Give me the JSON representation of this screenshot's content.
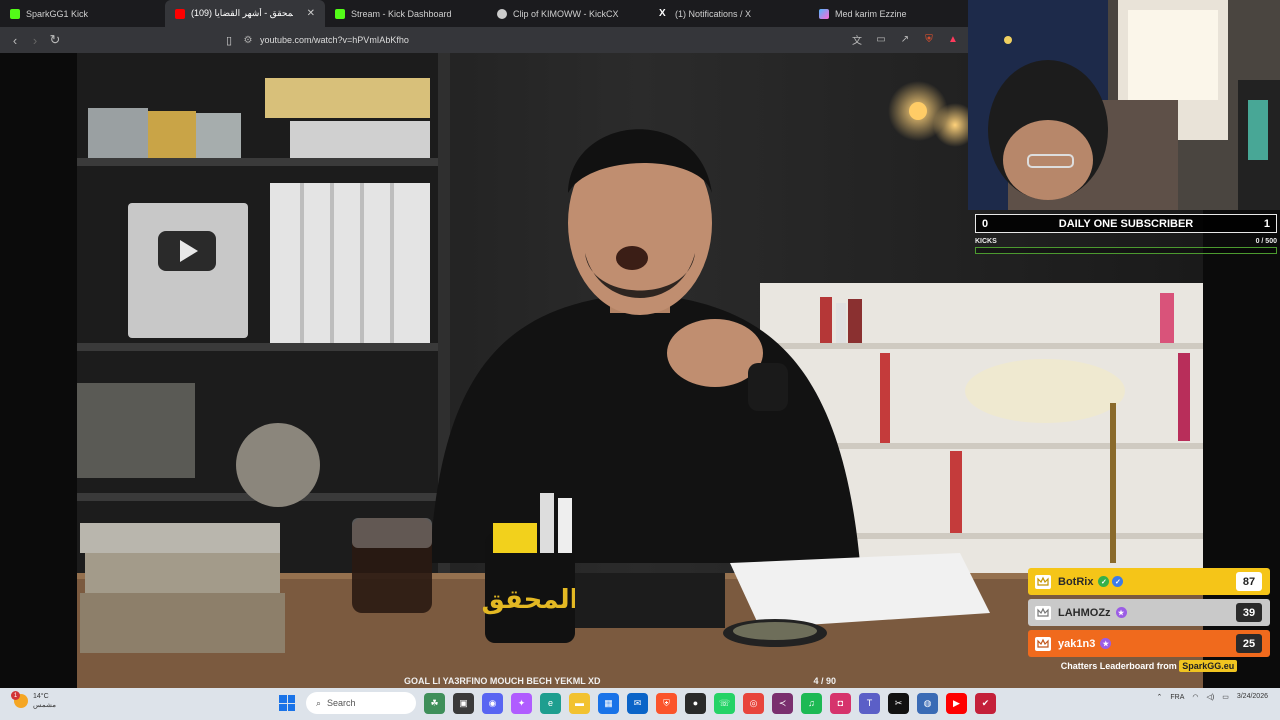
{
  "tabs": [
    {
      "label": "SparkGG1 Kick",
      "color": "#53fc18",
      "active": false
    },
    {
      "label": "(109) المحقق - أشهر القضايا !",
      "color": "#ff0000",
      "active": true
    },
    {
      "label": "Stream - Kick Dashboard",
      "color": "#53fc18",
      "active": false
    },
    {
      "label": "Clip of KIMOWW - KickCX",
      "color": "#cccccc",
      "active": false
    },
    {
      "label": "(1) Notifications / X",
      "color": "#ffffff",
      "active": false
    },
    {
      "label": "Med karim Ezzine",
      "color": "#4fb7ff",
      "active": false
    }
  ],
  "toolbar": {
    "url": "youtube.com/watch?v=hPVmIAbKfho"
  },
  "goal": {
    "left_value": "0",
    "title": "DAILY ONE SUBSCRIBER",
    "right_value": "1",
    "label": "KICKS",
    "progress": "0 / 500",
    "progress_fraction": 0
  },
  "leaderboard": {
    "rows": [
      {
        "name": "BotRix",
        "count": "87",
        "bg": "#f5c518",
        "text": "#2a2a2a"
      },
      {
        "name": "LAHMOZz",
        "count": "39",
        "bg": "#c9c9c9",
        "text": "#2a2a2a"
      },
      {
        "name": "yak1n3",
        "count": "25",
        "bg": "#f06a1d",
        "text": "#ffffff"
      }
    ],
    "footer_prefix": "Chatters Leaderboard from",
    "footer_brand": "SparkGG.eu"
  },
  "ticker": {
    "message": "GOAL LI YA3RFINO MOUCH BECH YEKML XD",
    "counter": "4  / 90"
  },
  "taskbar": {
    "temperature": "14°C",
    "weather_desc": "مشمس",
    "notif_count": "1",
    "search_label": "Search",
    "lang": "FRA",
    "date": "3/24/2026"
  }
}
